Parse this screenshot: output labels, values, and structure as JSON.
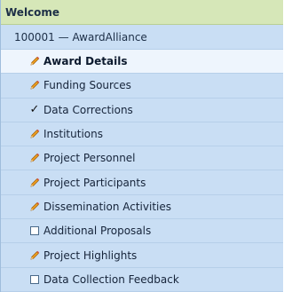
{
  "header": {
    "title": "Welcome"
  },
  "award": {
    "label": "100001 — AwardAlliance"
  },
  "colors": {
    "panel_bg": "#c9def4",
    "header_bg": "#d6e7b8",
    "active_row_bg": "#eef5fd",
    "pencil_body": "#f0a020"
  },
  "menu": {
    "items": [
      {
        "label": "Award Details",
        "icon": "pencil-icon",
        "active": true
      },
      {
        "label": "Funding Sources",
        "icon": "pencil-icon"
      },
      {
        "label": "Data Corrections",
        "icon": "checkmark-icon"
      },
      {
        "label": "Institutions",
        "icon": "pencil-icon"
      },
      {
        "label": "Project Personnel",
        "icon": "pencil-icon"
      },
      {
        "label": "Project Participants",
        "icon": "pencil-icon"
      },
      {
        "label": "Dissemination Activities",
        "icon": "pencil-icon"
      },
      {
        "label": "Additional Proposals",
        "icon": "empty-box-icon"
      },
      {
        "label": "Project Highlights",
        "icon": "pencil-icon"
      },
      {
        "label": "Data Collection Feedback",
        "icon": "empty-box-icon"
      }
    ]
  }
}
